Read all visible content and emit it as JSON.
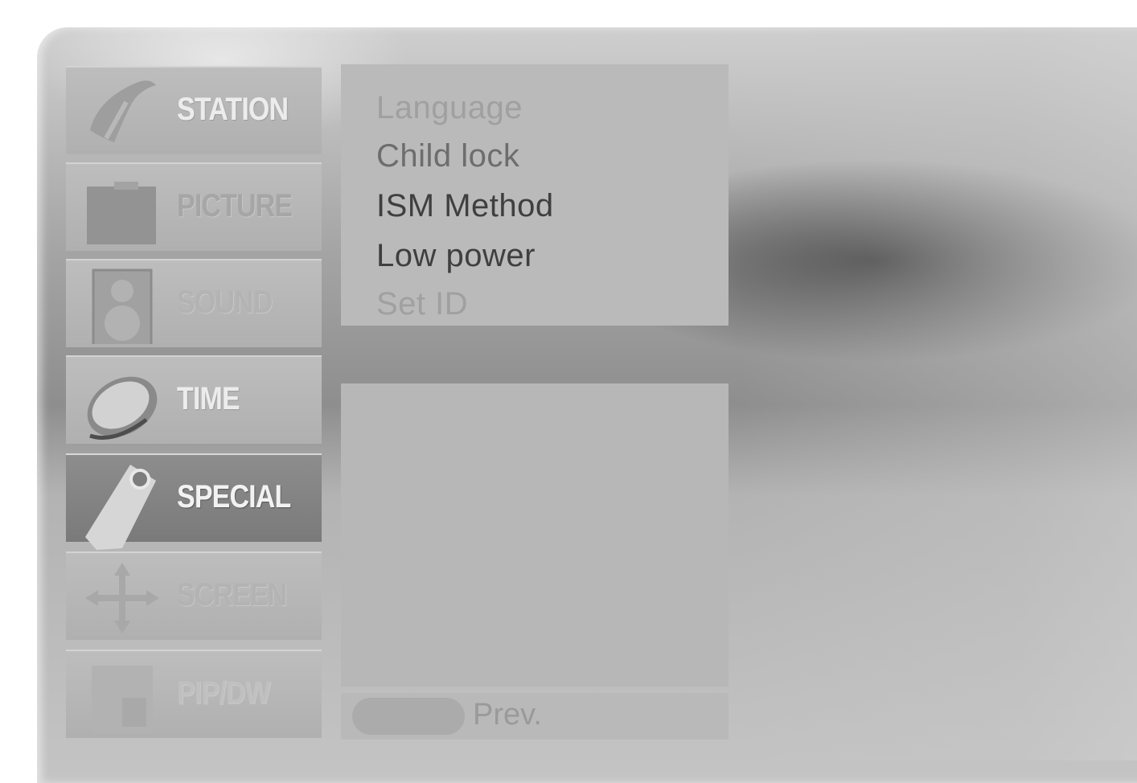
{
  "menu": {
    "tabs": [
      {
        "label": "STATION",
        "icon": "satellite-dish-icon"
      },
      {
        "label": "PICTURE",
        "icon": "picture-frame-icon"
      },
      {
        "label": "SOUND",
        "icon": "speaker-icon"
      },
      {
        "label": "TIME",
        "icon": "clock-icon"
      },
      {
        "label": "SPECIAL",
        "icon": "tag-icon",
        "selected": true
      },
      {
        "label": "SCREEN",
        "icon": "move-arrows-icon"
      },
      {
        "label": "PIP/DW",
        "icon": "pip-screen-icon"
      }
    ]
  },
  "submenu": {
    "items": [
      {
        "label": "Language"
      },
      {
        "label": "Child lock"
      },
      {
        "label": "ISM Method"
      },
      {
        "label": "Low power"
      },
      {
        "label": "Set ID"
      }
    ]
  },
  "footer": {
    "prev_label": "Prev."
  }
}
